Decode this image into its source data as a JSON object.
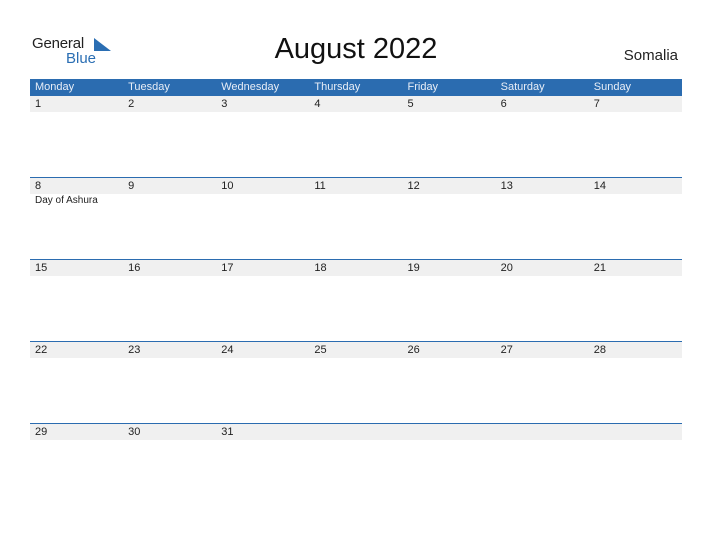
{
  "logo": {
    "general": "General",
    "blue": "Blue"
  },
  "title": "August 2022",
  "country": "Somalia",
  "colors": {
    "accent": "#2b6cb0",
    "row_bg": "#f0f0f0"
  },
  "weekdays": [
    "Monday",
    "Tuesday",
    "Wednesday",
    "Thursday",
    "Friday",
    "Saturday",
    "Sunday"
  ],
  "weeks": [
    {
      "dates": [
        "1",
        "2",
        "3",
        "4",
        "5",
        "6",
        "7"
      ],
      "events": [
        "",
        "",
        "",
        "",
        "",
        "",
        ""
      ]
    },
    {
      "dates": [
        "8",
        "9",
        "10",
        "11",
        "12",
        "13",
        "14"
      ],
      "events": [
        "Day of Ashura",
        "",
        "",
        "",
        "",
        "",
        ""
      ]
    },
    {
      "dates": [
        "15",
        "16",
        "17",
        "18",
        "19",
        "20",
        "21"
      ],
      "events": [
        "",
        "",
        "",
        "",
        "",
        "",
        ""
      ]
    },
    {
      "dates": [
        "22",
        "23",
        "24",
        "25",
        "26",
        "27",
        "28"
      ],
      "events": [
        "",
        "",
        "",
        "",
        "",
        "",
        ""
      ]
    },
    {
      "dates": [
        "29",
        "30",
        "31",
        "",
        "",
        "",
        ""
      ],
      "events": [
        "",
        "",
        "",
        "",
        "",
        "",
        ""
      ]
    }
  ]
}
